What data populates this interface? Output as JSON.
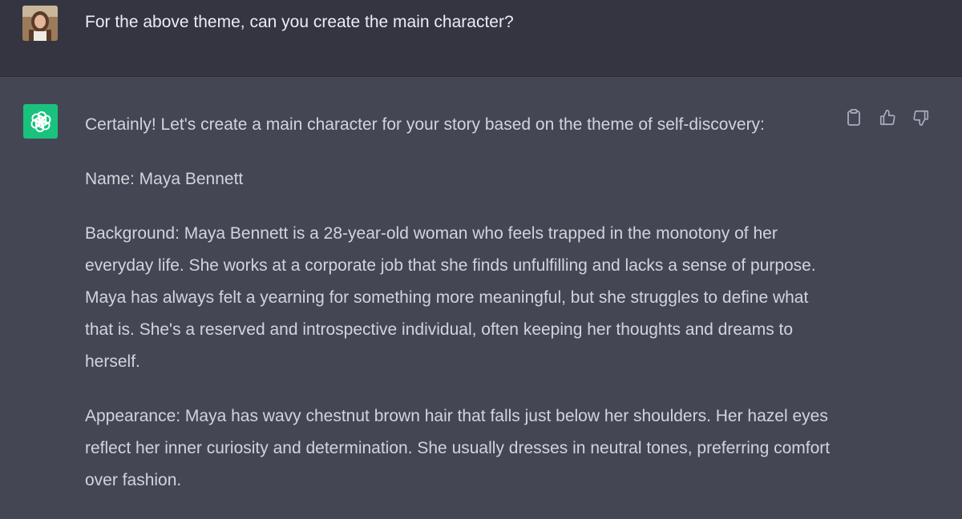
{
  "user_message": {
    "text": "For the above theme, can you create the main character?"
  },
  "assistant_message": {
    "paragraphs": [
      "Certainly! Let's create a main character for your story based on the theme of self-discovery:",
      "Name: Maya Bennett",
      "Background: Maya Bennett is a 28-year-old woman who feels trapped in the monotony of her everyday life. She works at a corporate job that she finds unfulfilling and lacks a sense of purpose. Maya has always felt a yearning for something more meaningful, but she struggles to define what that is. She's a reserved and introspective individual, often keeping her thoughts and dreams to herself.",
      "Appearance: Maya has wavy chestnut brown hair that falls just below her shoulders. Her hazel eyes reflect her inner curiosity and determination. She usually dresses in neutral tones, preferring comfort over fashion."
    ]
  },
  "actions": {
    "copy_icon": "clipboard-icon",
    "like_icon": "thumbs-up-icon",
    "dislike_icon": "thumbs-down-icon"
  },
  "colors": {
    "user_bg": "#343541",
    "assistant_bg": "#444654",
    "bot_avatar": "#19c37d",
    "text": "#d1d5db"
  }
}
